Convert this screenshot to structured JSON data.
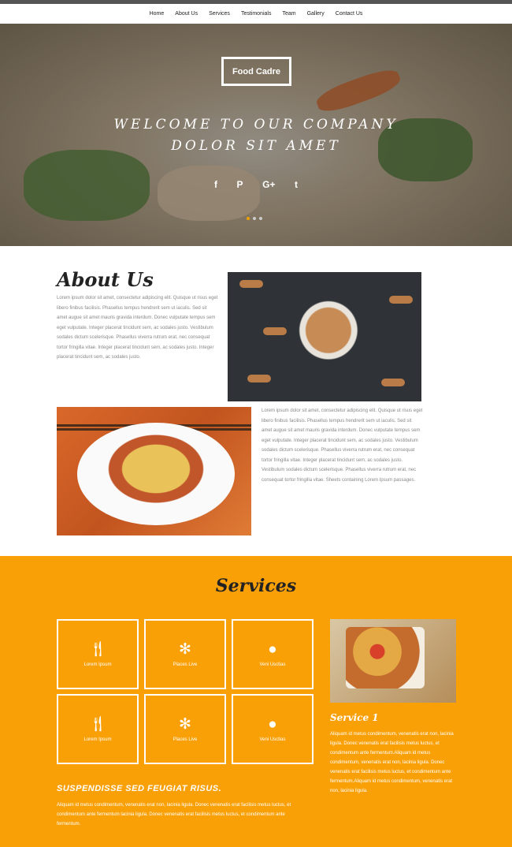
{
  "nav": {
    "items": [
      "Home",
      "About Us",
      "Services",
      "Testimonials",
      "Team",
      "Gallery",
      "Contact Us"
    ]
  },
  "hero": {
    "logo": "Food Cadre",
    "title_line1": "WELCOME TO OUR COMPANY",
    "title_line2": "DOLOR SIT AMET",
    "socials": [
      "f",
      "P",
      "G+",
      "t"
    ],
    "socials_icons": [
      "facebook-icon",
      "pinterest-icon",
      "google-plus-icon",
      "twitter-icon"
    ],
    "slide_count": 3,
    "active_slide": 1
  },
  "about": {
    "title": "About Us",
    "para1": "Lorem ipsum dolor sit amet, consectetur adipiscing elit. Quisque ut risus eget libero finibus facilisis. Phasellus tempus hendrerit sem ut iaculis. Sed sit amet augue sit amet mauris gravida interdum. Donec vulputate tempus sem eget vulputate. Integer placerat tincidunt sem, ac sodales justo. Vestibulum sodales dictum scelerisque. Phasellus viverra rutrum erat, nec consequat tortor fringilla vitae. Integer placerat tincidunt sem, ac sodales justo. Integer placerat tincidunt sem, ac sodales justo.",
    "para2": "Lorem ipsum dolor sit amet, consectetur adipiscing elit. Quisque ut risus eget libero finibus facilisis. Phasellus tempus hendrerit sem ut iaculis. Sed sit amet augue sit amet mauris gravida interdum. Donec vulputate tempus sem eget vulputate. Integer placerat tincidunt sem, ac sodales justo. Vestibulum sodales dictum scelerisque. Phasellus viverra rutrum erat, nec consequat tortor fringilla vitae. Integer placerat tincidunt sem, ac sodales justo. Vestibulum sodales dictum scelerisque. Phasellus viverra rutrum erat, nec consequat tortor fringilla vitae. Sheets containing Lorem Ipsum passages."
  },
  "services": {
    "title": "Services",
    "boxes": [
      {
        "label": "Lorem Ipsum",
        "icon": "cutlery-icon"
      },
      {
        "label": "Places Live",
        "icon": "asterisk-icon"
      },
      {
        "label": "Veni Usctias",
        "icon": "user-icon"
      },
      {
        "label": "Lorem Ipsum",
        "icon": "cutlery-icon"
      },
      {
        "label": "Places Live",
        "icon": "asterisk-icon"
      },
      {
        "label": "Veni Usctias",
        "icon": "user-icon"
      }
    ],
    "service1_title": "Service 1",
    "service1_text": "Aliquam id metus condimentum, venenatis erat non, lacinia ligula. Donec venenatis erat facilisis metus luctus, et condimentum ante fermentum.Aliquam id metus condimentum, venenatis erat non, lacinia ligula. Donec venenatis erat facilisis metus luctus, et condimentum ante fermentum.Aliquam id metus condimentum, venenatis erat non, lacinia ligula.",
    "sub_title": "SUSPENDISSE SED FEUGIAT RISUS.",
    "sub_text": "Aliquam id metus condimentum, venenatis erat non, lacinia ligula. Donec venenatis erat facilisis metus luctus, et condimentum ante fermentum lacinia ligula. Donec venenatis erat facilisis metus luctus, et condimentum ante fermentum."
  }
}
